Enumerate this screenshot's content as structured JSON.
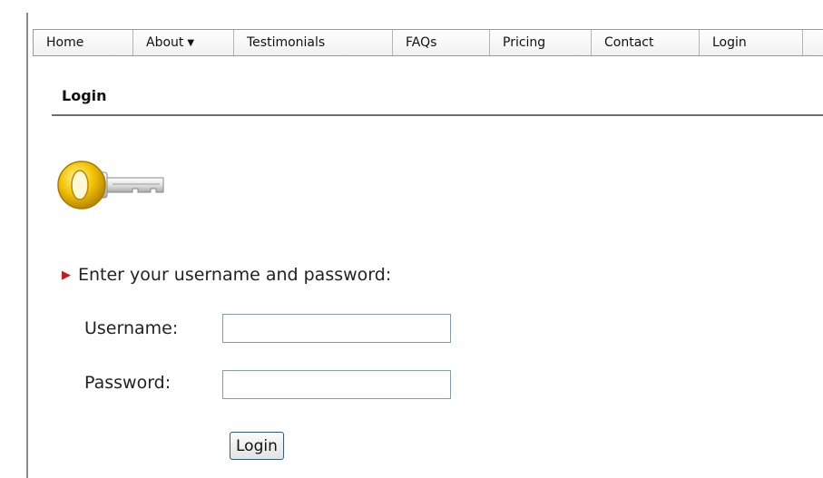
{
  "nav": {
    "items": [
      {
        "label": "Home",
        "has_caret": false
      },
      {
        "label": "About",
        "has_caret": true
      },
      {
        "label": "Testimonials",
        "has_caret": false
      },
      {
        "label": "FAQs",
        "has_caret": false
      },
      {
        "label": "Pricing",
        "has_caret": false
      },
      {
        "label": "Contact",
        "has_caret": false
      },
      {
        "label": "Login",
        "has_caret": false
      }
    ],
    "caret_glyph": "▼"
  },
  "page": {
    "title": "Login",
    "key_icon": "key-icon"
  },
  "form": {
    "prompt_arrow": "▶",
    "prompt": "Enter your username and password:",
    "username_label": "Username:",
    "username_value": "",
    "password_label": "Password:",
    "password_value": "",
    "submit_label": "Login"
  },
  "colors": {
    "prompt_arrow": "#cc1a1a",
    "key_gold": "#f2c200",
    "input_border": "#7f9db9"
  }
}
